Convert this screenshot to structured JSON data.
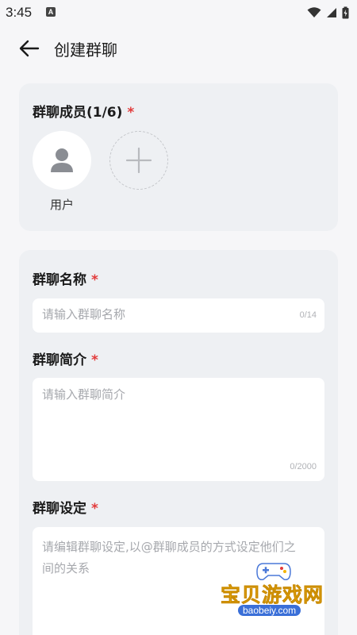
{
  "status": {
    "time": "3:45",
    "app_icon_letter": "A"
  },
  "header": {
    "title": "创建群聊"
  },
  "members": {
    "label": "群聊成员(1/6)",
    "required_mark": "*",
    "users": [
      {
        "name": "用户"
      }
    ]
  },
  "group_name": {
    "label": "群聊名称",
    "required_mark": "*",
    "placeholder": "请输入群聊名称",
    "counter": "0/14"
  },
  "group_intro": {
    "label": "群聊简介",
    "required_mark": "*",
    "placeholder": "请输入群聊简介",
    "counter": "0/2000"
  },
  "group_setting": {
    "label": "群聊设定",
    "required_mark": "*",
    "placeholder": "请编辑群聊设定,以@群聊成员的方式设定他们之间的关系"
  },
  "watermark": {
    "name": "宝贝游戏网",
    "url": "baobeiy.com"
  }
}
